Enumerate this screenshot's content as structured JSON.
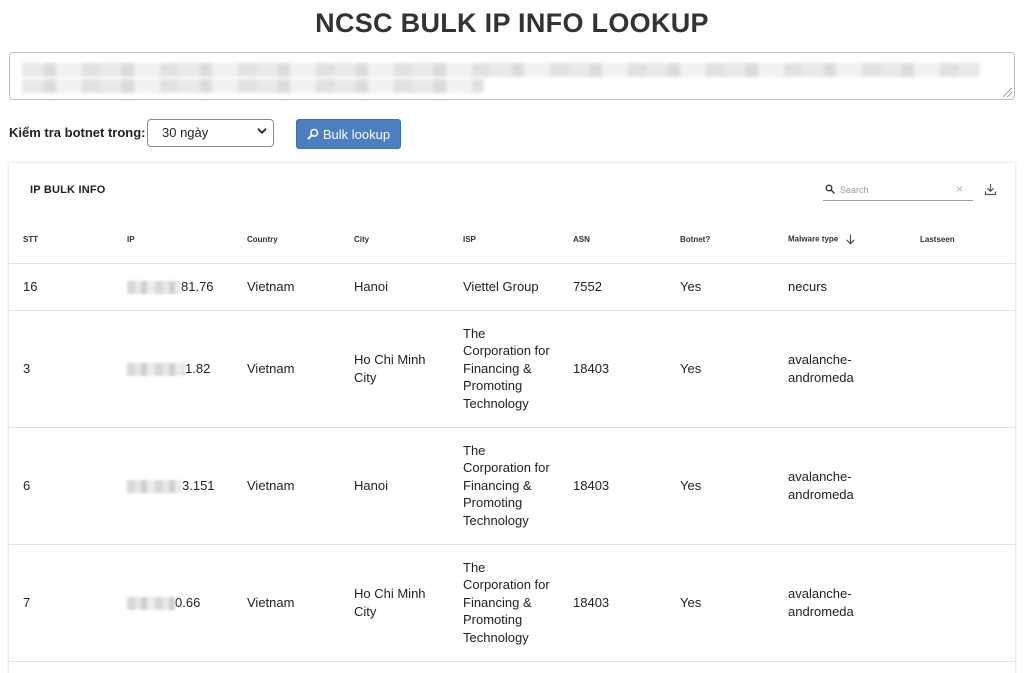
{
  "page": {
    "title": "NCSC BULK IP INFO LOOKUP"
  },
  "controls": {
    "botnet_label": "Kiểm tra botnet trong:",
    "period_value": "30 ngày",
    "bulk_button_label": "Bulk lookup"
  },
  "card": {
    "title": "IP BULK INFO",
    "search_placeholder": "Search"
  },
  "table": {
    "headers": {
      "stt": "STT",
      "ip": "IP",
      "country": "Country",
      "city": "City",
      "isp": "ISP",
      "asn": "ASN",
      "botnet": "Botnet?",
      "malware": "Malware type",
      "lastseen": "Lastseen"
    },
    "rows": [
      {
        "stt": "16",
        "ip_suffix": "81.76",
        "country": "Vietnam",
        "city": "Hanoi",
        "isp": "Viettel Group",
        "asn": "7552",
        "botnet": "Yes",
        "malware": "necurs",
        "lastseen": ""
      },
      {
        "stt": "3",
        "ip_suffix": "1.82",
        "country": "Vietnam",
        "city": "Ho Chi Minh City",
        "isp": "The Corporation for Financing & Promoting Technology",
        "asn": "18403",
        "botnet": "Yes",
        "malware": "avalanche-andromeda",
        "lastseen": ""
      },
      {
        "stt": "6",
        "ip_suffix": "3.151",
        "country": "Vietnam",
        "city": "Hanoi",
        "isp": "The Corporation for Financing & Promoting Technology",
        "asn": "18403",
        "botnet": "Yes",
        "malware": "avalanche-andromeda",
        "lastseen": ""
      },
      {
        "stt": "7",
        "ip_suffix": "0.66",
        "country": "Vietnam",
        "city": "Ho Chi Minh City",
        "isp": "The Corporation for Financing & Promoting Technology",
        "asn": "18403",
        "botnet": "Yes",
        "malware": "avalanche-andromeda",
        "lastseen": ""
      }
    ]
  },
  "icons": {
    "search": "search-icon",
    "magnifier": "magnifier-icon",
    "clear": "close-icon",
    "download": "download-icon",
    "sort": "arrow-down-icon",
    "select_chevron": "chevron-down-icon"
  },
  "colors": {
    "accent": "#4a7fc1",
    "title": "#333333"
  }
}
